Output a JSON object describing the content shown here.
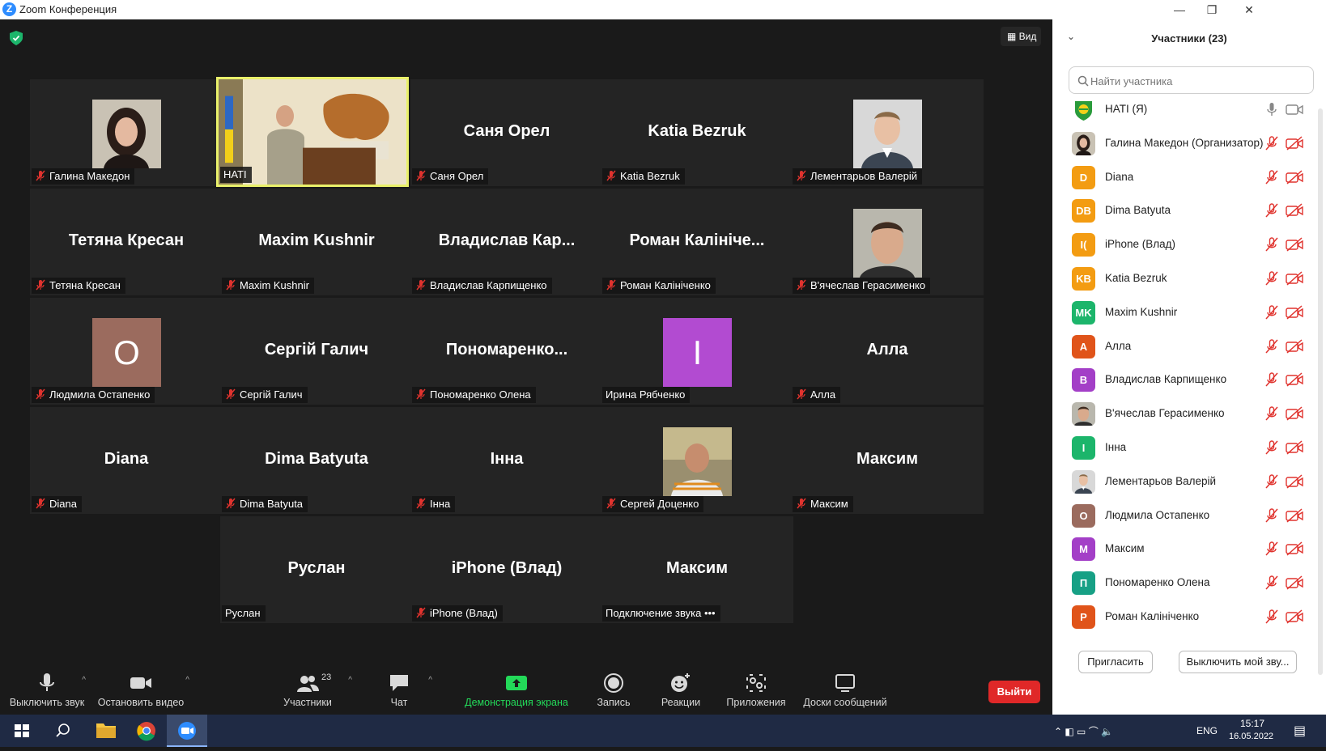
{
  "window": {
    "title": "Zoom Конференция",
    "min": "—",
    "restore": "❐",
    "close": "✕"
  },
  "stage": {
    "view_label": "Вид"
  },
  "tiles": [
    {
      "big": "",
      "label": "Галина Македон",
      "muted": true,
      "photo": "woman"
    },
    {
      "big": "",
      "label": "НАТІ",
      "muted": false,
      "photo": "lecture",
      "speaker": true
    },
    {
      "big": "Саня Орел",
      "label": "Саня Орел",
      "muted": true
    },
    {
      "big": "Katia Bezruk",
      "label": "Katia Bezruk",
      "muted": true
    },
    {
      "big": "",
      "label": "Лементарьов Валерій",
      "muted": true,
      "photo": "man1"
    },
    {
      "big": "Тетяна Кресан",
      "label": "Тетяна Кресан",
      "muted": true
    },
    {
      "big": "Maxim Kushnir",
      "label": "Maxim Kushnir",
      "muted": true
    },
    {
      "big": "Владислав  Кар...",
      "label": "Владислав Карпищенко",
      "muted": true
    },
    {
      "big": "Роман  Калініче...",
      "label": "Роман Калініченко",
      "muted": true
    },
    {
      "big": "",
      "label": "В'ячеслав Герасименко",
      "muted": true,
      "photo": "man2"
    },
    {
      "big": "",
      "label": "Людмила Остапенко",
      "muted": true,
      "avatar_letter": "O",
      "avatar_color": "#9b6b5e"
    },
    {
      "big": "Сергій Галич",
      "label": "Сергій Галич",
      "muted": true
    },
    {
      "big": "Пономаренко...",
      "label": "Пономаренко Олена",
      "muted": true
    },
    {
      "big": "",
      "label": "Ирина Рябченко",
      "muted": false,
      "avatar_letter": "I",
      "avatar_color": "#b24bd1"
    },
    {
      "big": "Алла",
      "label": "Алла",
      "muted": true
    },
    {
      "big": "Diana",
      "label": "Diana",
      "muted": true
    },
    {
      "big": "Dima Batyuta",
      "label": "Dima Batyuta",
      "muted": true
    },
    {
      "big": "Інна",
      "label": "Інна",
      "muted": true
    },
    {
      "big": "",
      "label": "Сергей Доценко",
      "muted": true,
      "photo": "man3"
    },
    {
      "big": "Максим",
      "label": "Максим",
      "muted": true
    },
    {
      "big": "Руслан",
      "label": "Руслан",
      "muted": false
    },
    {
      "big": "iPhone (Влад)",
      "label": "iPhone (Влад)",
      "muted": true
    },
    {
      "big": "Максим",
      "label": "Подключение звука",
      "muted": false,
      "dots": "•••"
    }
  ],
  "toolbar": {
    "mute": "Выключить звук",
    "video": "Остановить видео",
    "participants": "Участники",
    "participants_count": "23",
    "chat": "Чат",
    "share": "Демонстрация экрана",
    "record": "Запись",
    "reactions": "Реакции",
    "apps": "Приложения",
    "whiteboards": "Доски сообщений",
    "leave": "Выйти"
  },
  "panel": {
    "title": "Участники (23)",
    "search_placeholder": "Найти участника",
    "invite": "Пригласить",
    "mute_me": "Выключить мой зву..."
  },
  "participants": [
    {
      "name": "НАТІ (Я)",
      "avatar": "",
      "color": "#ffffff",
      "img": "logo",
      "me": true
    },
    {
      "name": "Галина Македон (Организатор)",
      "avatar": "",
      "color": "#555555",
      "img": "woman"
    },
    {
      "name": "Diana",
      "avatar": "D",
      "color": "#f39c12"
    },
    {
      "name": "Dima Batyuta",
      "avatar": "DB",
      "color": "#f39c12"
    },
    {
      "name": "iPhone (Влад)",
      "avatar": "I(",
      "color": "#f39c12"
    },
    {
      "name": "Katia Bezruk",
      "avatar": "KB",
      "color": "#f39c12"
    },
    {
      "name": "Maxim Kushnir",
      "avatar": "MK",
      "color": "#1cb56b"
    },
    {
      "name": "Алла",
      "avatar": "А",
      "color": "#e0541a"
    },
    {
      "name": "Владислав Карпищенко",
      "avatar": "В",
      "color": "#a33fc7"
    },
    {
      "name": "В'ячеслав Герасименко",
      "avatar": "",
      "color": "#666666",
      "img": "man2"
    },
    {
      "name": "Інна",
      "avatar": "І",
      "color": "#1cb56b"
    },
    {
      "name": "Лементарьов Валерій",
      "avatar": "",
      "color": "#888888",
      "img": "man1"
    },
    {
      "name": "Людмила Остапенко",
      "avatar": "О",
      "color": "#9b6b5e"
    },
    {
      "name": "Максим",
      "avatar": "М",
      "color": "#a33fc7"
    },
    {
      "name": "Пономаренко Олена",
      "avatar": "П",
      "color": "#17a085"
    },
    {
      "name": "Роман Калініченко",
      "avatar": "Р",
      "color": "#e0541a"
    }
  ],
  "taskbar": {
    "time": "15:17",
    "date": "16.05.2022",
    "lang": "ENG"
  },
  "colors": {
    "accent": "#2D8CFF",
    "leave": "#e02828",
    "muted_red": "#e0332e",
    "share_green": "#23d959",
    "speaker_border": "#e9f06a"
  }
}
